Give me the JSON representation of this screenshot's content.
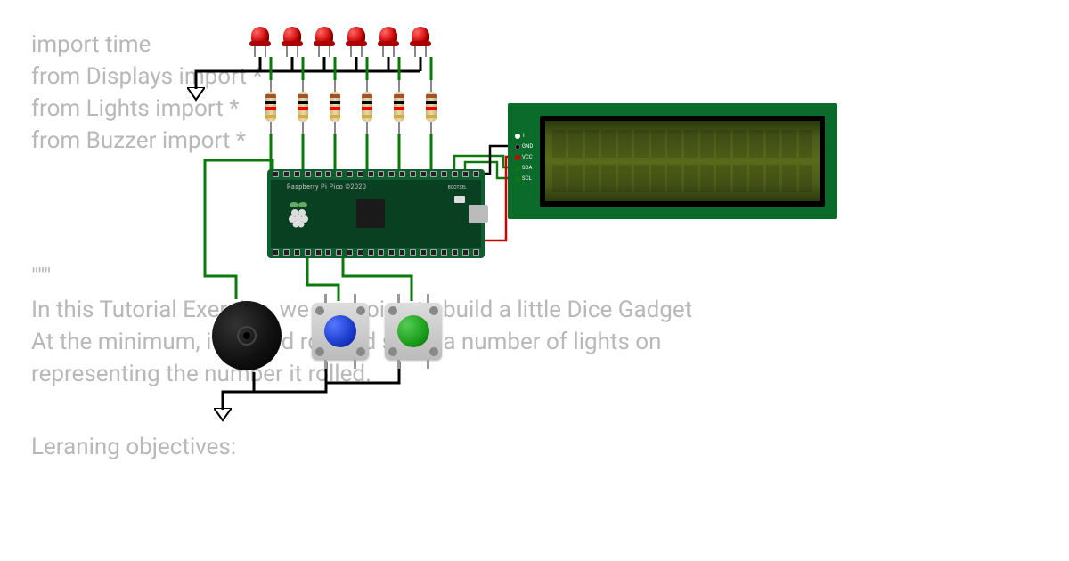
{
  "code": {
    "lines": [
      "import time",
      "from Displays import *",
      "from Lights import *",
      "from Buzzer import *",
      "",
      "",
      "\"\"\"",
      "In this Tutorial Exercise, we are going to build a little Dice Gadget",
      "At the minimum, it should roll and show a number of lights on",
      "representing the number it rolled.",
      "",
      "Leraning objectives:"
    ]
  },
  "board": {
    "label": "Raspberry Pi Pico ©2020",
    "bootsel": "BOOTSEL"
  },
  "lcd": {
    "pins": [
      "1",
      "GND",
      "VCC",
      "SDA",
      "SCL"
    ],
    "cols": 16,
    "rows": 2
  },
  "components": {
    "leds": 6,
    "led_color": "#cc0000",
    "resistor_bands": [
      "#a0522d",
      "#000000",
      "#ff0000",
      "#d4af37"
    ],
    "button1_color": "#1a3acc",
    "button2_color": "#1a9e1a"
  },
  "wiring": {
    "gnd_color": "#000000",
    "signal_color": "#0b7a0b",
    "vcc_color": "#cc0000"
  }
}
